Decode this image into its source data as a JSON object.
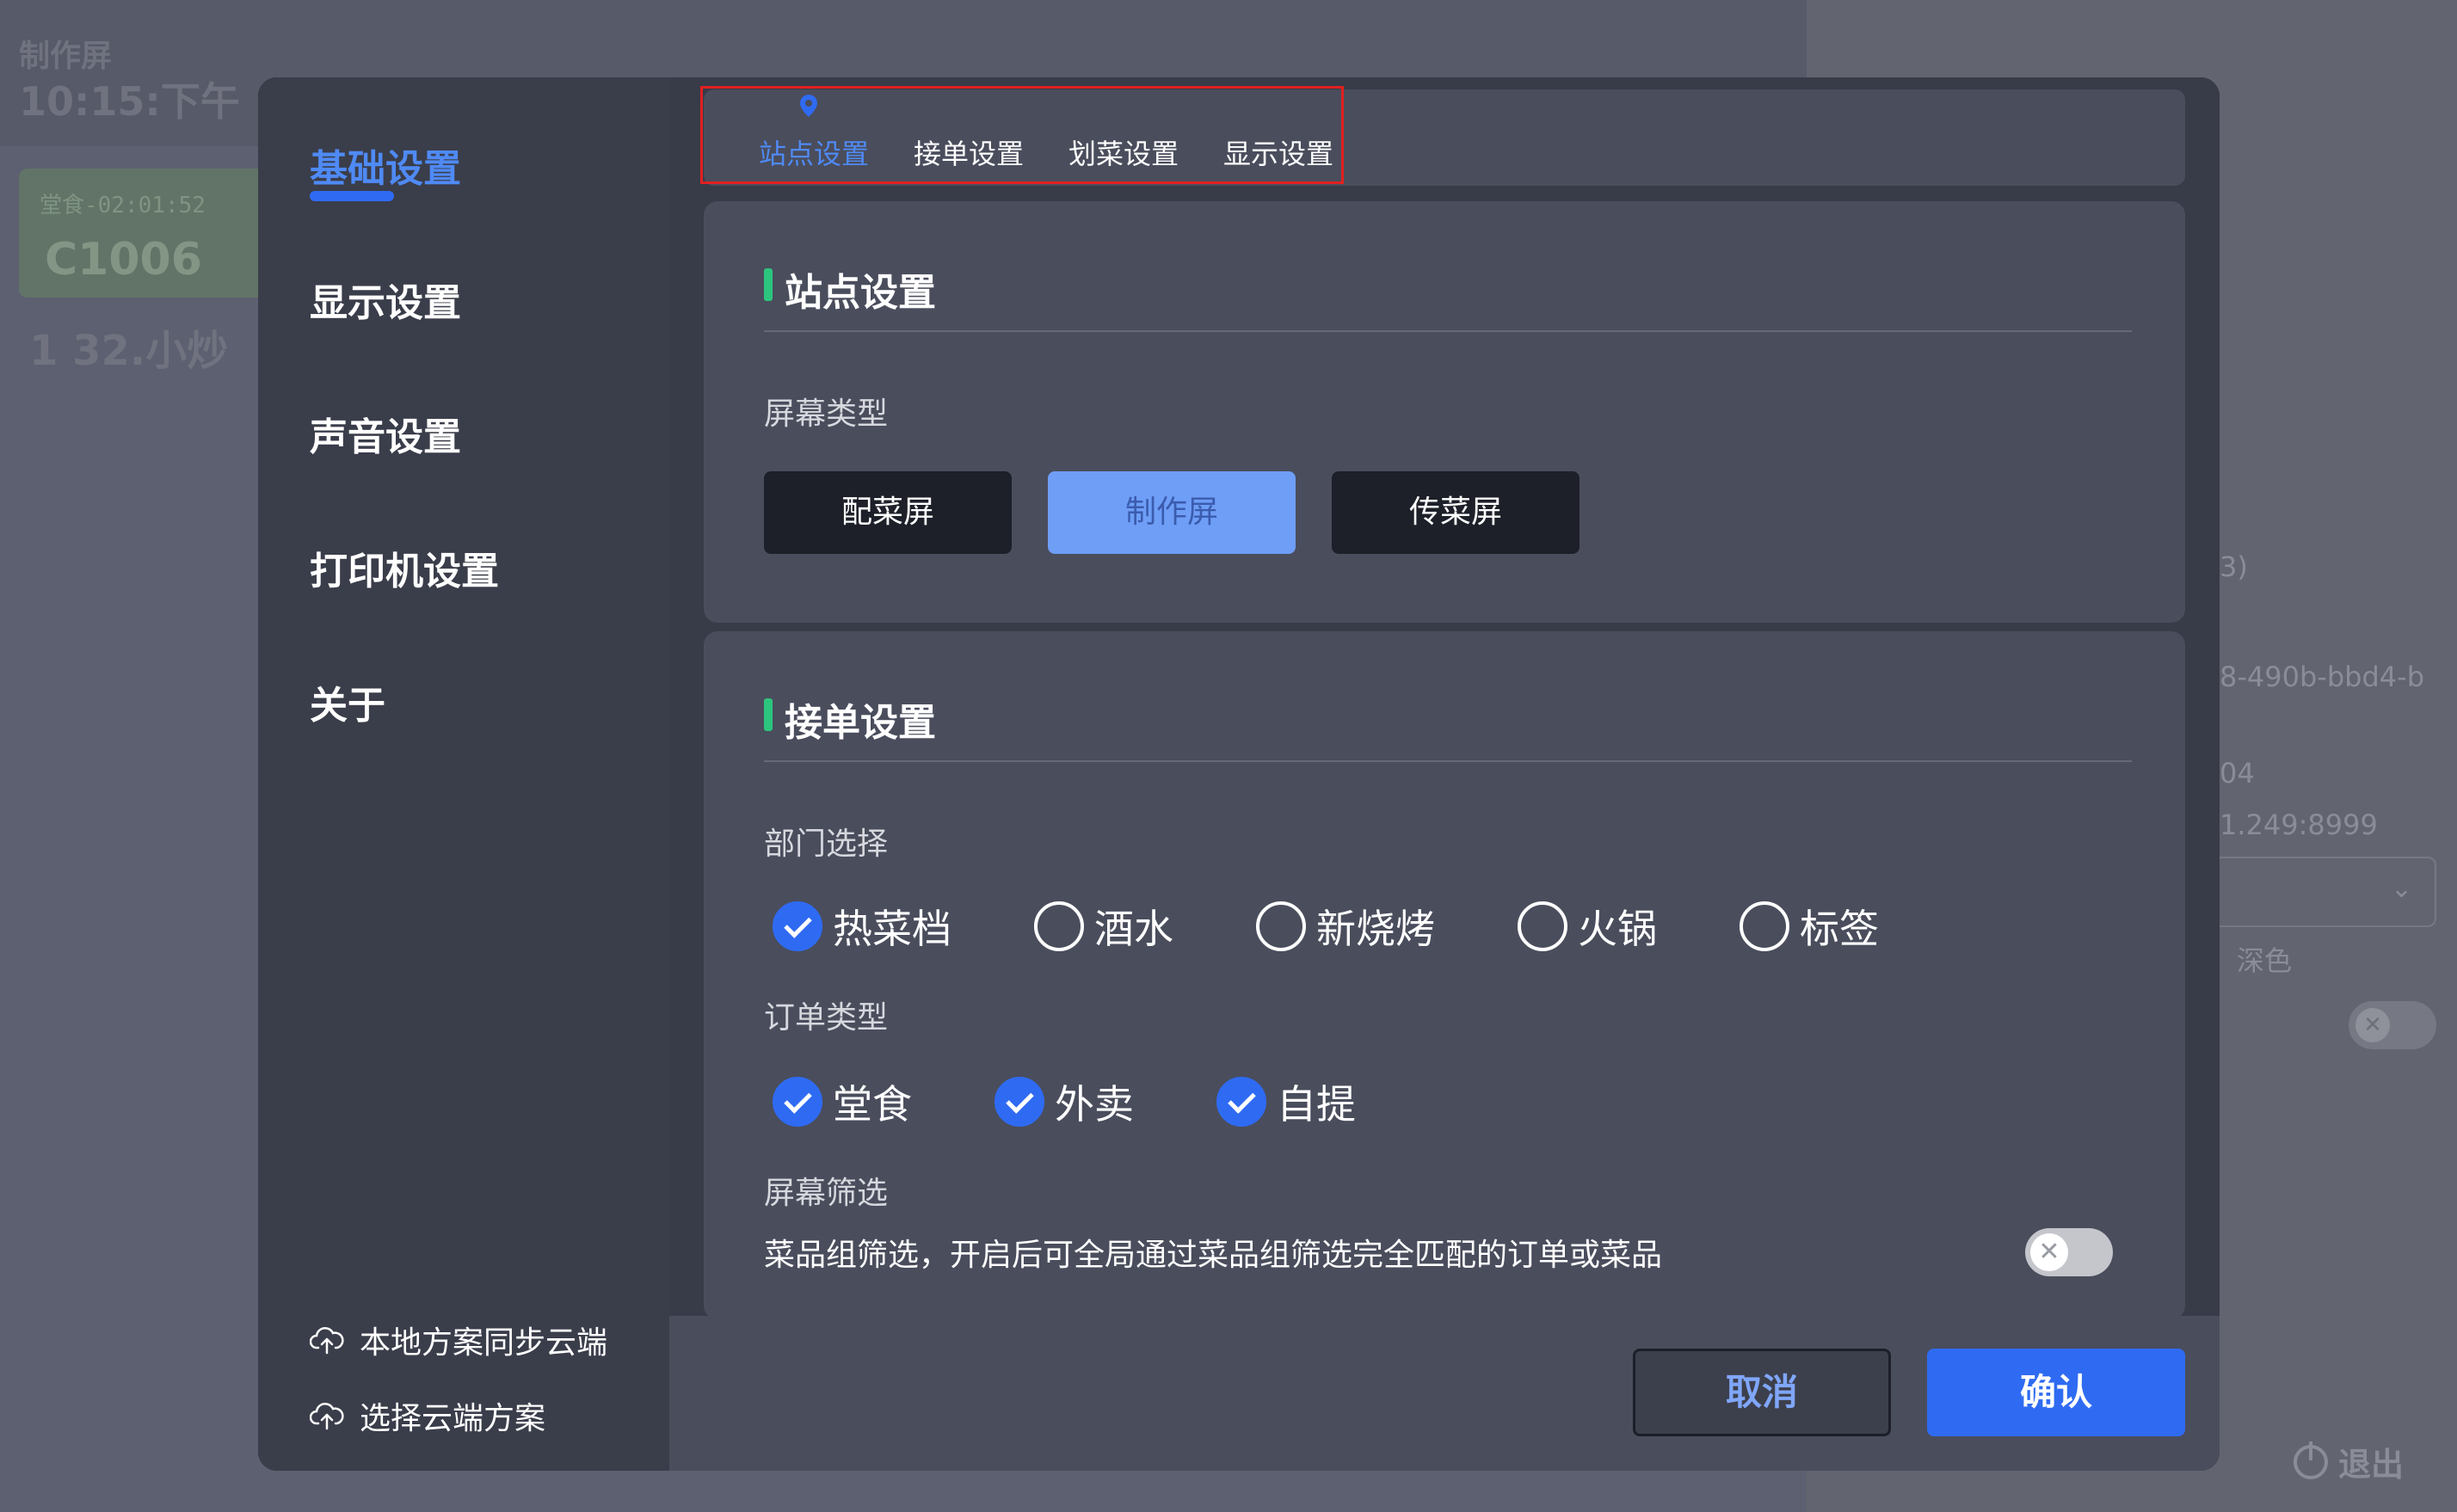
{
  "background": {
    "screen_name": "制作屏",
    "clock": "10:15:下午",
    "card_timer": "堂食-02:01:52",
    "card_order": "C1006",
    "dish": "1 32.小炒",
    "info_lines": [
      "3)",
      "8-490b-bbd4-b",
      "04",
      "1.249:8999"
    ],
    "dark_label": "深色",
    "exit_label": "退出"
  },
  "sidebar": {
    "items": [
      {
        "label": "基础设置",
        "active": true
      },
      {
        "label": "显示设置"
      },
      {
        "label": "声音设置"
      },
      {
        "label": "打印机设置"
      },
      {
        "label": "关于"
      }
    ],
    "actions": [
      {
        "label": "本地方案同步云端",
        "icon": "cloud-upload-icon"
      },
      {
        "label": "选择云端方案",
        "icon": "cloud-download-icon"
      }
    ]
  },
  "tabs": [
    {
      "label": "站点设置",
      "active": true
    },
    {
      "label": "接单设置"
    },
    {
      "label": "划菜设置"
    },
    {
      "label": "显示设置"
    }
  ],
  "station": {
    "title": "站点设置",
    "screen_type_label": "屏幕类型",
    "screen_types": [
      {
        "label": "配菜屏"
      },
      {
        "label": "制作屏",
        "active": true
      },
      {
        "label": "传菜屏"
      }
    ]
  },
  "orders": {
    "title": "接单设置",
    "department_label": "部门选择",
    "departments": [
      {
        "label": "热菜档",
        "checked": true
      },
      {
        "label": "酒水",
        "checked": false
      },
      {
        "label": "新烧烤",
        "checked": false
      },
      {
        "label": "火锅",
        "checked": false
      },
      {
        "label": "标签",
        "checked": false
      }
    ],
    "order_type_label": "订单类型",
    "order_types": [
      {
        "label": "堂食",
        "checked": true
      },
      {
        "label": "外卖",
        "checked": true
      },
      {
        "label": "自提",
        "checked": true
      }
    ],
    "screen_filter_label": "屏幕筛选",
    "screen_filter_text": "菜品组筛选，开启后可全局通过菜品组筛选完全匹配的订单或菜品",
    "screen_filter_enabled": false
  },
  "footer": {
    "cancel_label": "取消",
    "confirm_label": "确认"
  },
  "colors": {
    "accent": "#2f6bf2",
    "active_text": "#4f8af5",
    "title_bar": "#2cc57d",
    "highlight": "#e02020"
  }
}
